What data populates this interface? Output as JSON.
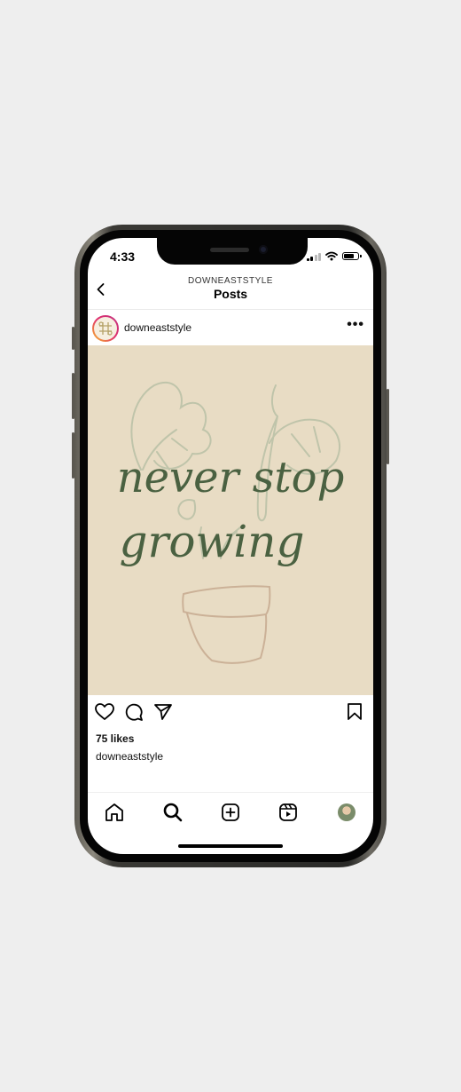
{
  "status_bar": {
    "time": "4:33"
  },
  "header": {
    "account": "DOWNEASTSTYLE",
    "title": "Posts"
  },
  "post": {
    "username": "downeaststyle",
    "image_text": {
      "line1": "never stop",
      "line2": "growing"
    },
    "likes": "75 likes",
    "caption_user": "downeaststyle"
  },
  "icons": {
    "back": "chevron-left-icon",
    "more": "more-horizontal-icon",
    "like": "heart-icon",
    "comment": "comment-icon",
    "share": "paper-plane-icon",
    "save": "bookmark-icon",
    "home": "home-icon",
    "search": "search-icon",
    "create": "plus-square-icon",
    "reels": "reels-icon",
    "profile": "profile-avatar"
  },
  "colors": {
    "image_bg": "#e8dcc4",
    "script_text": "#4a6141",
    "sketch": "#b8bfa4"
  }
}
